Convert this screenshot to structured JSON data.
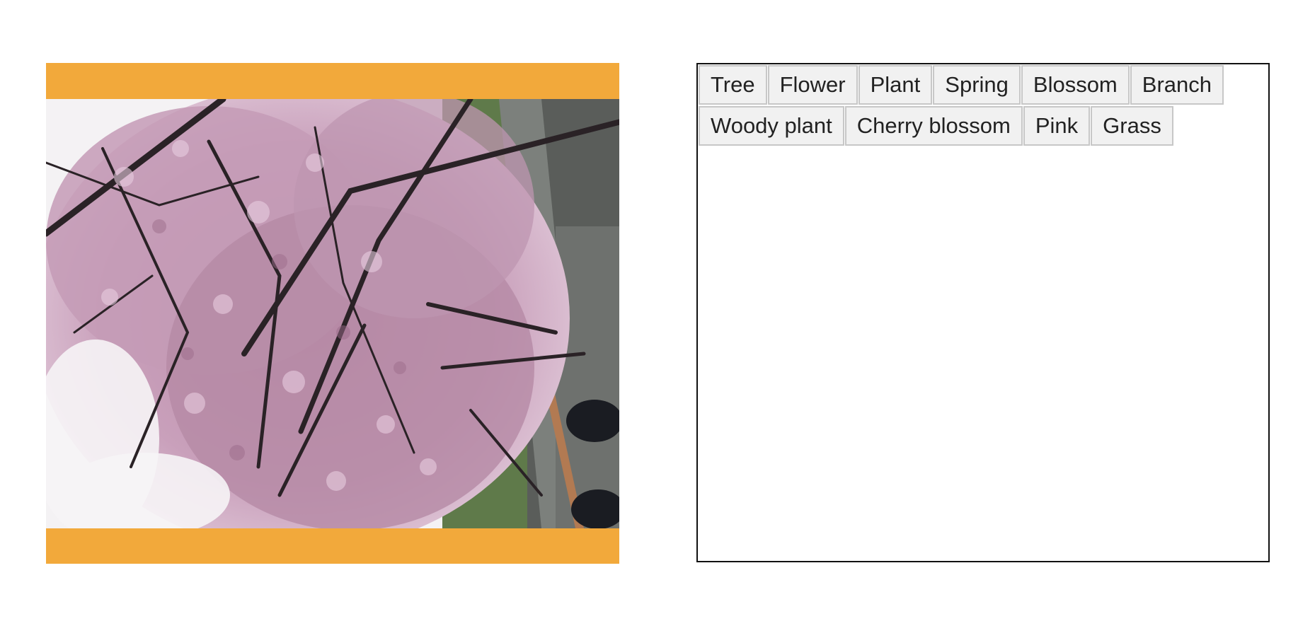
{
  "labels": {
    "items": [
      "Tree",
      "Flower",
      "Plant",
      "Spring",
      "Blossom",
      "Branch",
      "Woody plant",
      "Cherry blossom",
      "Pink",
      "Grass"
    ]
  },
  "colors": {
    "letterbox_bars": "#f2a93b",
    "panel_border": "#111111",
    "chip_background": "#f1f1f1",
    "chip_border": "#c7c7c7"
  }
}
